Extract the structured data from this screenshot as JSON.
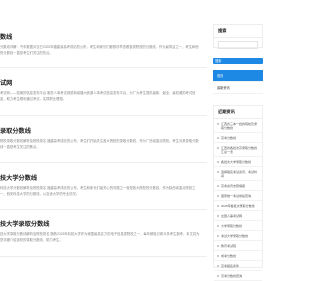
{
  "articles": [
    {
      "title": "数线",
      "excerpt": "分数线详解：汽车数据对当已2025年福建省高考成绩的公布，考生和家长们都想尽早查看各类院校的分数线，作为最简洁之一，考生和他的分数线一直是考生们关注的热点。"
    },
    {
      "title": "试网",
      "excerpt": "考试网——权威的信息发布平台 服务人事考试网是新增福州资源人事考试信息发布平台，为广大考生提供最新、最全、最权威的考试信息，助力考生顺利通过考试，实现职业理想。"
    },
    {
      "title": "录取分数线",
      "excerpt": "院校录取分数线解析及院校排名 福建高考成绩的公布，考生们开始关注各大院校的录取分数线，作为广西省重点院校，考生对其录取分数线一直是考生关注的焦点。"
    },
    {
      "title": "技大学分数线",
      "excerpt": "科技大学分数线解析及院校排名 福建高考成绩的公布，考生和家长们最关心的问题之一就是各大院校的分数线，作为陕西省重点院校之一，西安科技大学的分数线，以及该大学的专业情况。"
    },
    {
      "title": "技大学录取分数线",
      "excerpt": "技大学录取分数线解析及院校排名 随着2025年科技大学作为我国最具实力的电子信息类院校之一，每年都吸引着众多考生报考，本文将为您详细介绍该校的录取分数线，助力考生。"
    },
    {
      "title": "",
      "excerpt": ""
    }
  ],
  "sidebar": {
    "search_title": "搜索",
    "search_placeholder": "",
    "search_button": "搜索",
    "menu": [
      {
        "label": "首页"
      },
      {
        "label": "最新资讯"
      }
    ],
    "recent_title": "近期资讯",
    "recent_posts": [
      "江西省三本一批的院校及录取分数线",
      "高考分数线",
      "江西省各批次高录取分数线汇总一览",
      "各批次大学录取分数线",
      "选择报名考试资讯，考试时间",
      "高考资讯志愿填报",
      "国家统一考试成绩查询",
      "2025年各批次录取分数线",
      "全国人事考试网",
      "大学录取分数线",
      "考试大学录取分数线",
      "教育考试院",
      "成考分数线",
      "高考报名条件",
      "高考分数线查询"
    ]
  },
  "colors": {
    "accent": "#1e88e5"
  }
}
